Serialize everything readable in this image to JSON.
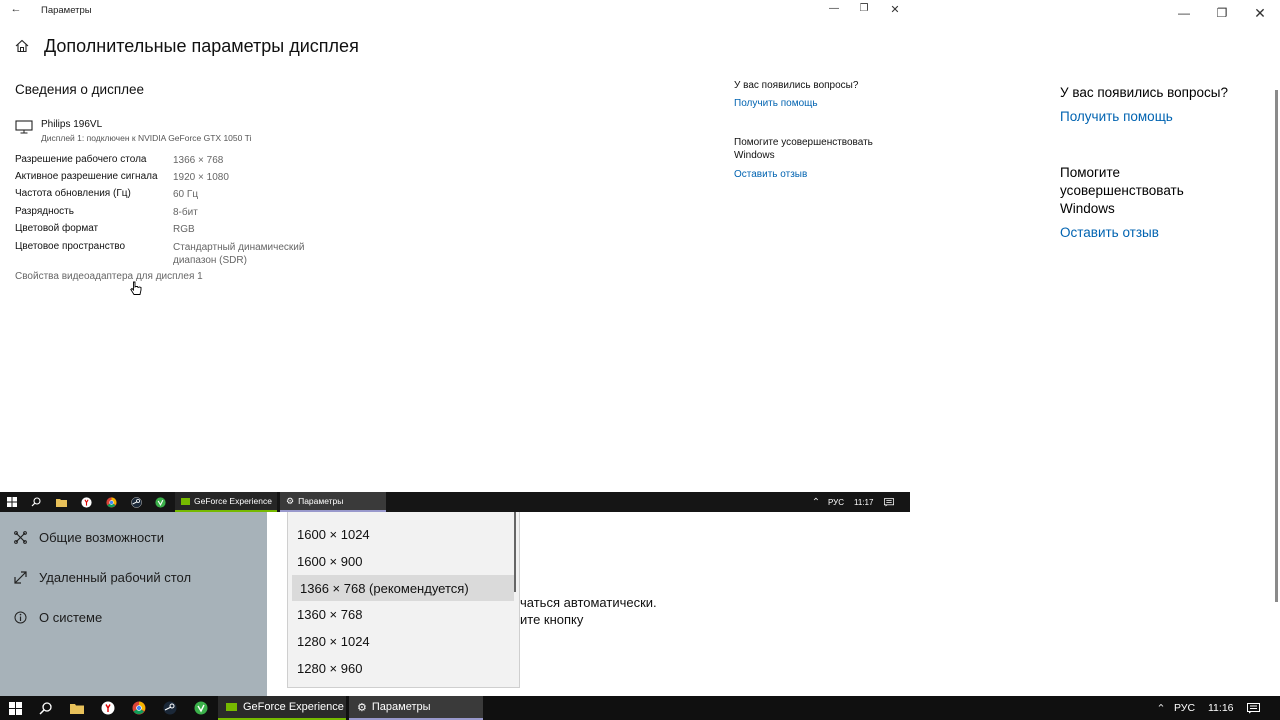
{
  "outer": {
    "help": {
      "question": "У вас появились вопросы?",
      "get_help": "Получить помощь",
      "improve": "Помогите усовершенствовать Windows",
      "feedback": "Оставить отзыв"
    },
    "sidebar": {
      "items": [
        {
          "label": "Общие возможности",
          "icon": "accessibility-icon"
        },
        {
          "label": "Удаленный рабочий стол",
          "icon": "remote-desktop-icon"
        },
        {
          "label": "О системе",
          "icon": "info-icon"
        }
      ]
    },
    "main_text": {
      "line1": "чаться автоматически.",
      "line2": "ите кнопку"
    },
    "dropdown": {
      "options": [
        "1600 × 1024",
        "1600 × 900",
        "1366 × 768 (рекомендуется)",
        "1360 × 768",
        "1280 × 1024",
        "1280 × 960"
      ],
      "selected": "1366 × 768 (рекомендуется)"
    },
    "taskbar": {
      "tasks": [
        "GeForce Experience",
        "Параметры"
      ],
      "language": "РУС",
      "time": "11:16"
    }
  },
  "inner": {
    "title": "Параметры",
    "page_title": "Дополнительные параметры дисплея",
    "section_title": "Сведения о дисплее",
    "monitor": {
      "name": "Philips 196VL",
      "subtitle": "Дисплей 1: подключен к NVIDIA GeForce GTX 1050 Ti"
    },
    "rows": [
      {
        "label": "Разрешение рабочего стола",
        "value": "1366 × 768"
      },
      {
        "label": "Активное разрешение сигнала",
        "value": "1920 × 1080"
      },
      {
        "label": "Частота обновления (Гц)",
        "value": "60 Гц"
      },
      {
        "label": "Разрядность",
        "value": "8-бит"
      },
      {
        "label": "Цветовой формат",
        "value": "RGB"
      },
      {
        "label": "Цветовое пространство",
        "value": "Стандартный динамический диапазон (SDR)"
      }
    ],
    "adapter_link": "Свойства видеоадаптера для дисплея 1",
    "help": {
      "question": "У вас появились вопросы?",
      "get_help": "Получить помощь",
      "improve": "Помогите усовершенствовать Windows",
      "feedback": "Оставить отзыв"
    },
    "taskbar": {
      "tasks": [
        "GeForce Experience",
        "Параметры"
      ],
      "language": "РУС",
      "time": "11:17"
    }
  },
  "colors": {
    "link": "#0063b1",
    "taskbar": "#101010",
    "sidebar": "#a7b2b9"
  }
}
